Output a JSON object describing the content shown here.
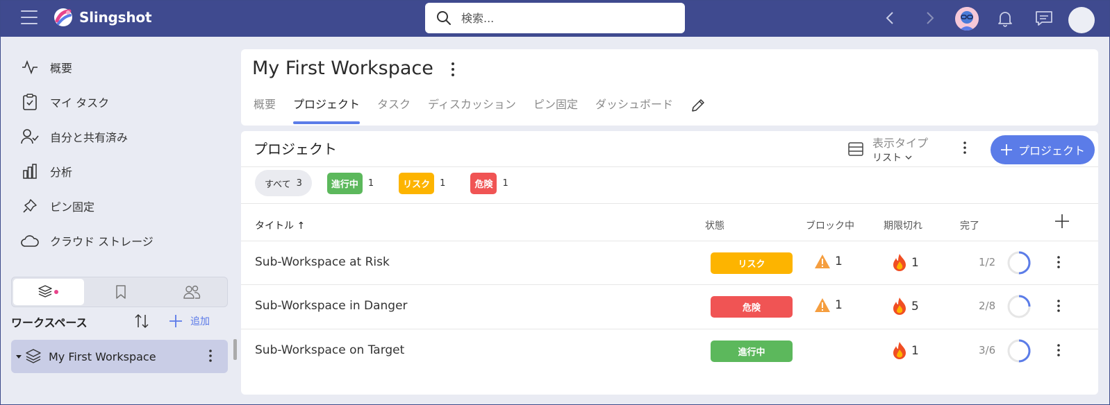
{
  "app": {
    "name": "Slingshot"
  },
  "search": {
    "placeholder": "検索..."
  },
  "colors": {
    "accent": "#5b7ce8",
    "topbar": "#3f4a8f",
    "risk": "#fdb400",
    "danger": "#f05454",
    "ontrack": "#5cb85c"
  },
  "sidebar": {
    "items": [
      {
        "label": "概要",
        "icon": "activity-icon"
      },
      {
        "label": "マイ タスク",
        "icon": "clipboard-check-icon"
      },
      {
        "label": "自分と共有済み",
        "icon": "user-check-icon"
      },
      {
        "label": "分析",
        "icon": "bar-chart-icon"
      },
      {
        "label": "ピン固定",
        "icon": "pin-icon"
      },
      {
        "label": "クラウド ストレージ",
        "icon": "cloud-icon"
      }
    ],
    "workspace_section": {
      "title": "ワークスペース",
      "add_label": "追加"
    },
    "workspaces": [
      {
        "name": "My First Workspace"
      }
    ]
  },
  "workspace": {
    "name": "My First Workspace",
    "tabs": [
      {
        "label": "概要"
      },
      {
        "label": "プロジェクト",
        "active": true
      },
      {
        "label": "タスク"
      },
      {
        "label": "ディスカッション"
      },
      {
        "label": "ピン固定"
      },
      {
        "label": "ダッシュボード"
      }
    ]
  },
  "projects": {
    "title": "プロジェクト",
    "view_type": {
      "label": "表示タイプ",
      "value": "リスト"
    },
    "add_button": "プロジェクト",
    "filters": {
      "all": {
        "label": "すべて",
        "count": "3"
      },
      "chips": [
        {
          "label": "進行中",
          "count": "1",
          "color": "#5cb85c"
        },
        {
          "label": "リスク",
          "count": "1",
          "color": "#fdb400"
        },
        {
          "label": "危険",
          "count": "1",
          "color": "#f05454"
        }
      ]
    },
    "columns": {
      "title": "タイトル ↑",
      "status": "状態",
      "blocked": "ブロック中",
      "overdue": "期限切れ",
      "done": "完了"
    },
    "rows": [
      {
        "name": "Sub-Workspace at Risk",
        "status": "リスク",
        "status_color": "#fdb400",
        "blocked": "1",
        "overdue": "1",
        "done": "1/2",
        "progress": 0.5
      },
      {
        "name": "Sub-Workspace in Danger",
        "status": "危険",
        "status_color": "#f05454",
        "blocked": "1",
        "overdue": "5",
        "done": "2/8",
        "progress": 0.25
      },
      {
        "name": "Sub-Workspace on Target",
        "status": "進行中",
        "status_color": "#5cb85c",
        "blocked": "",
        "overdue": "1",
        "done": "3/6",
        "progress": 0.5
      }
    ]
  }
}
